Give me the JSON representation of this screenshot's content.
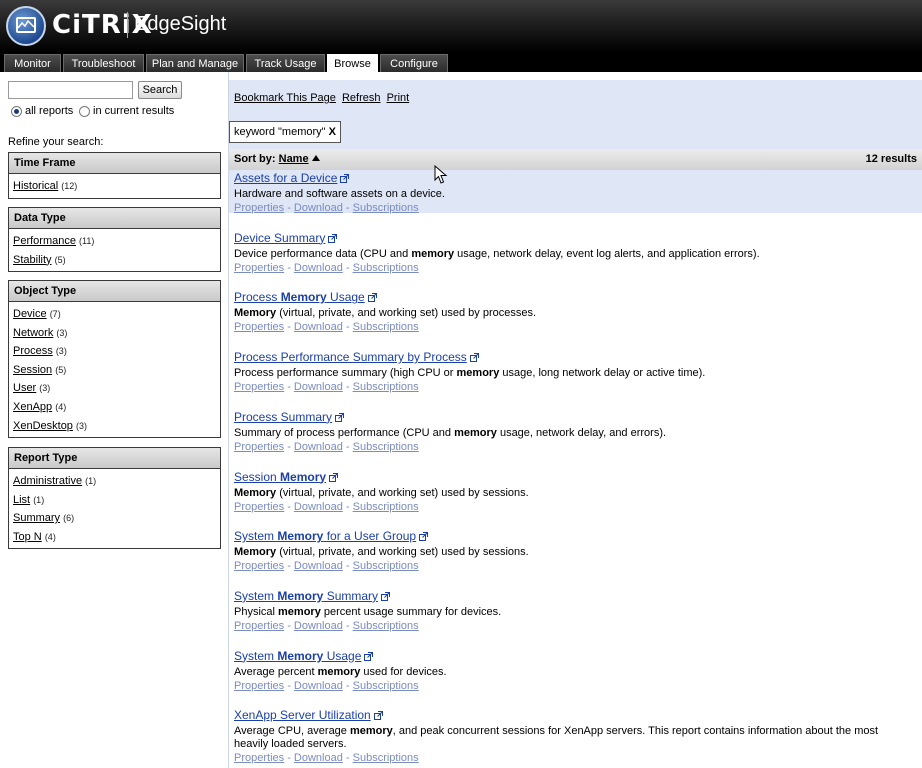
{
  "header": {
    "brand": "CiTRiX",
    "product": "EdgeSight"
  },
  "tabs": [
    {
      "label": "Monitor",
      "active": false
    },
    {
      "label": "Troubleshoot",
      "active": false
    },
    {
      "label": "Plan and Manage",
      "active": false
    },
    {
      "label": "Track Usage",
      "active": false
    },
    {
      "label": "Browse",
      "active": true
    },
    {
      "label": "Configure",
      "active": false
    }
  ],
  "sidebar": {
    "search_value": "",
    "search_button": "Search",
    "scope": {
      "all": "all reports",
      "current": "in current results",
      "selected": "all"
    },
    "refine_label": "Refine your search:",
    "facets": [
      {
        "title": "Time Frame",
        "items": [
          {
            "label": "Historical",
            "count": "(12)"
          }
        ]
      },
      {
        "title": "Data Type",
        "items": [
          {
            "label": "Performance",
            "count": "(11)"
          },
          {
            "label": "Stability",
            "count": "(5)"
          }
        ]
      },
      {
        "title": "Object Type",
        "items": [
          {
            "label": "Device",
            "count": "(7)"
          },
          {
            "label": "Network",
            "count": "(3)"
          },
          {
            "label": "Process",
            "count": "(3)"
          },
          {
            "label": "Session",
            "count": "(5)"
          },
          {
            "label": "User",
            "count": "(3)"
          },
          {
            "label": "XenApp",
            "count": "(4)"
          },
          {
            "label": "XenDesktop",
            "count": "(3)"
          }
        ]
      },
      {
        "title": "Report Type",
        "items": [
          {
            "label": "Administrative",
            "count": "(1)"
          },
          {
            "label": "List",
            "count": "(1)"
          },
          {
            "label": "Summary",
            "count": "(6)"
          },
          {
            "label": "Top N",
            "count": "(4)"
          }
        ]
      }
    ]
  },
  "toolbar": {
    "bookmark": "Bookmark This Page",
    "refresh": "Refresh",
    "print": "Print"
  },
  "filter": {
    "label": "keyword \"memory\"",
    "remove": "X"
  },
  "sortbar": {
    "sort_by": "Sort by:",
    "sort_field": "Name",
    "count": "12 results"
  },
  "result_links": {
    "properties": "Properties",
    "download": "Download",
    "subscriptions": "Subscriptions",
    "sep": "-"
  },
  "results": [
    {
      "title": [
        [
          "Assets for a Device",
          false
        ]
      ],
      "desc": [
        [
          "Hardware and software assets on a device.",
          false
        ]
      ]
    },
    {
      "title": [
        [
          "Device Summary",
          false
        ]
      ],
      "desc": [
        [
          "Device performance data (CPU and ",
          false
        ],
        [
          "memory",
          true
        ],
        [
          " usage, network delay, event log alerts, and application errors).",
          false
        ]
      ]
    },
    {
      "title": [
        [
          "Process ",
          false
        ],
        [
          "Memory",
          true
        ],
        [
          " Usage",
          false
        ]
      ],
      "desc": [
        [
          "Memory",
          true
        ],
        [
          " (virtual, private, and working set) used by processes.",
          false
        ]
      ]
    },
    {
      "title": [
        [
          "Process Performance Summary by Process",
          false
        ]
      ],
      "desc": [
        [
          "Process performance summary (high CPU or ",
          false
        ],
        [
          "memory",
          true
        ],
        [
          " usage, long network delay or active time).",
          false
        ]
      ]
    },
    {
      "title": [
        [
          "Process Summary",
          false
        ]
      ],
      "desc": [
        [
          "Summary of process performance (CPU and ",
          false
        ],
        [
          "memory",
          true
        ],
        [
          " usage, network delay, and errors).",
          false
        ]
      ]
    },
    {
      "title": [
        [
          "Session ",
          false
        ],
        [
          "Memory",
          true
        ]
      ],
      "desc": [
        [
          "Memory",
          true
        ],
        [
          " (virtual, private, and working set) used by sessions.",
          false
        ]
      ]
    },
    {
      "title": [
        [
          "System ",
          false
        ],
        [
          "Memory",
          true
        ],
        [
          " for a User Group",
          false
        ]
      ],
      "desc": [
        [
          "Memory",
          true
        ],
        [
          " (virtual, private, and working set) used by sessions.",
          false
        ]
      ]
    },
    {
      "title": [
        [
          "System ",
          false
        ],
        [
          "Memory",
          true
        ],
        [
          " Summary",
          false
        ]
      ],
      "desc": [
        [
          "Physical ",
          false
        ],
        [
          "memory",
          true
        ],
        [
          " percent usage summary for devices.",
          false
        ]
      ]
    },
    {
      "title": [
        [
          "System ",
          false
        ],
        [
          "Memory",
          true
        ],
        [
          " Usage",
          false
        ]
      ],
      "desc": [
        [
          "Average percent ",
          false
        ],
        [
          "memory",
          true
        ],
        [
          " used for devices.",
          false
        ]
      ]
    },
    {
      "title": [
        [
          "XenApp Server Utilization",
          false
        ]
      ],
      "desc": [
        [
          "Average CPU, average ",
          false
        ],
        [
          "memory",
          true
        ],
        [
          ", and peak concurrent sessions for XenApp servers. This report contains information about the most heavily loaded servers.",
          false
        ]
      ]
    }
  ]
}
